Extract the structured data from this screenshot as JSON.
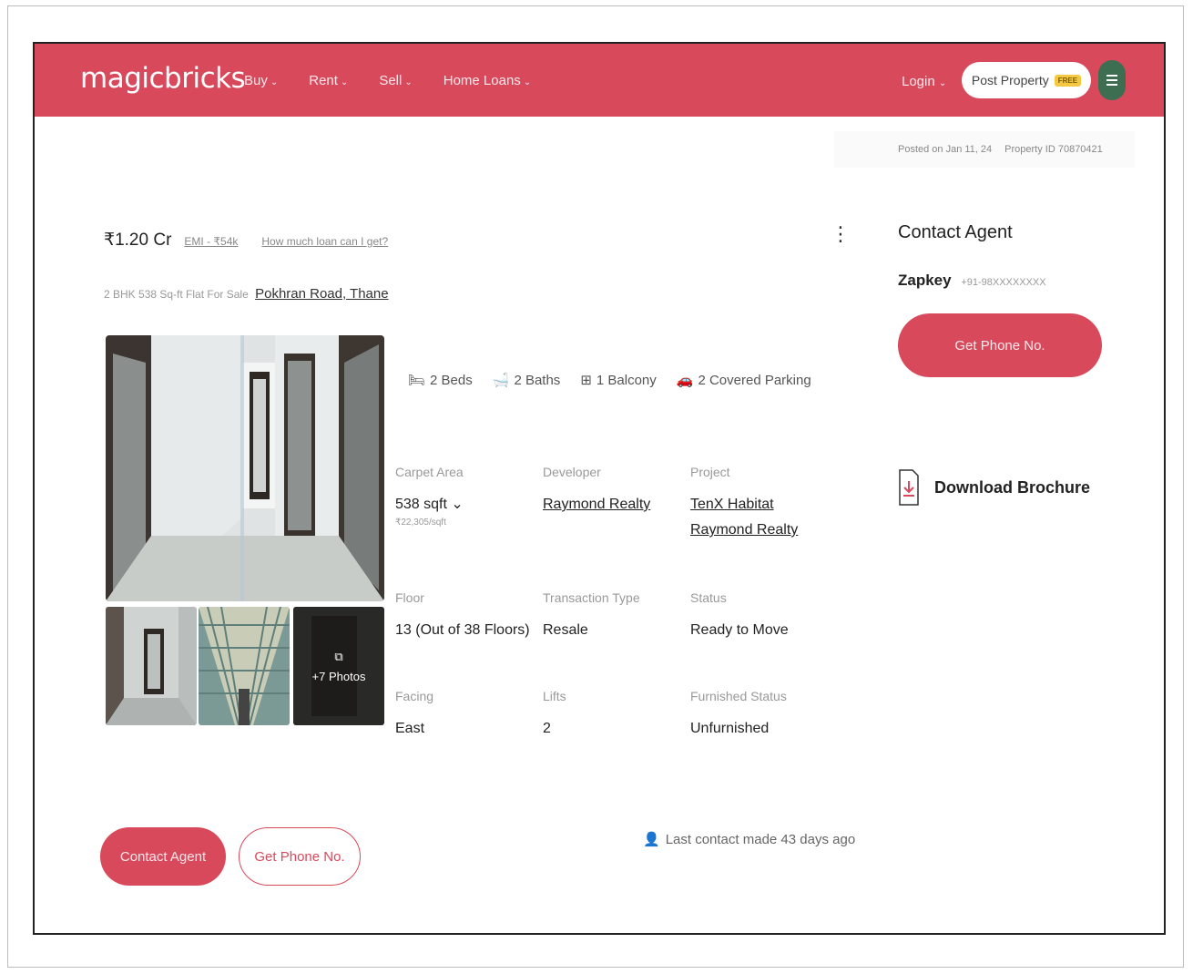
{
  "header": {
    "logo": "magicbricks",
    "nav": [
      {
        "label": "Buy"
      },
      {
        "label": "Rent"
      },
      {
        "label": "Sell"
      },
      {
        "label": "Home Loans"
      }
    ],
    "login": "Login",
    "post_property": "Post Property",
    "free_badge": "FREE"
  },
  "meta": {
    "posted": "Posted on Jan 11, 24",
    "property_id": "Property ID 70870421"
  },
  "listing": {
    "price": "₹1.20 Cr",
    "emi": "EMI - ₹54k",
    "loan_link": "How much loan can I get?",
    "subtitle": "2 BHK 538 Sq-ft Flat For Sale",
    "location": "Pokhran Road, Thane",
    "more_photos": "+7 Photos"
  },
  "amenities": [
    {
      "label": "2 Beds",
      "icon": "bed-icon"
    },
    {
      "label": "2 Baths",
      "icon": "bath-icon"
    },
    {
      "label": "1 Balcony",
      "icon": "balcony-icon"
    },
    {
      "label": "2 Covered Parking",
      "icon": "parking-icon"
    }
  ],
  "details": [
    {
      "label": "Carpet Area",
      "value": "538 sqft",
      "sub": "₹22,305/sqft"
    },
    {
      "label": "Developer",
      "value": "Raymond Realty"
    },
    {
      "label": "Project",
      "value": "TenX Habitat Raymond Realty"
    },
    {
      "label": "Floor",
      "value": "13 (Out of 38 Floors)"
    },
    {
      "label": "Transaction Type",
      "value": "Resale"
    },
    {
      "label": "Status",
      "value": "Ready to Move"
    },
    {
      "label": "Facing",
      "value": "East"
    },
    {
      "label": "Lifts",
      "value": "2"
    },
    {
      "label": "Furnished Status",
      "value": "Unfurnished"
    }
  ],
  "sidebar": {
    "title": "Contact Agent",
    "agent_name": "Zapkey",
    "agent_phone": "+91-98XXXXXXXX",
    "phone_button": "Get Phone No.",
    "brochure": "Download Brochure"
  },
  "footer": {
    "contact_agent": "Contact Agent",
    "get_phone": "Get Phone No.",
    "last_contact": "Last contact made 43 days ago"
  },
  "colors": {
    "brand": "#d8495c",
    "menu": "#3d6e52"
  }
}
